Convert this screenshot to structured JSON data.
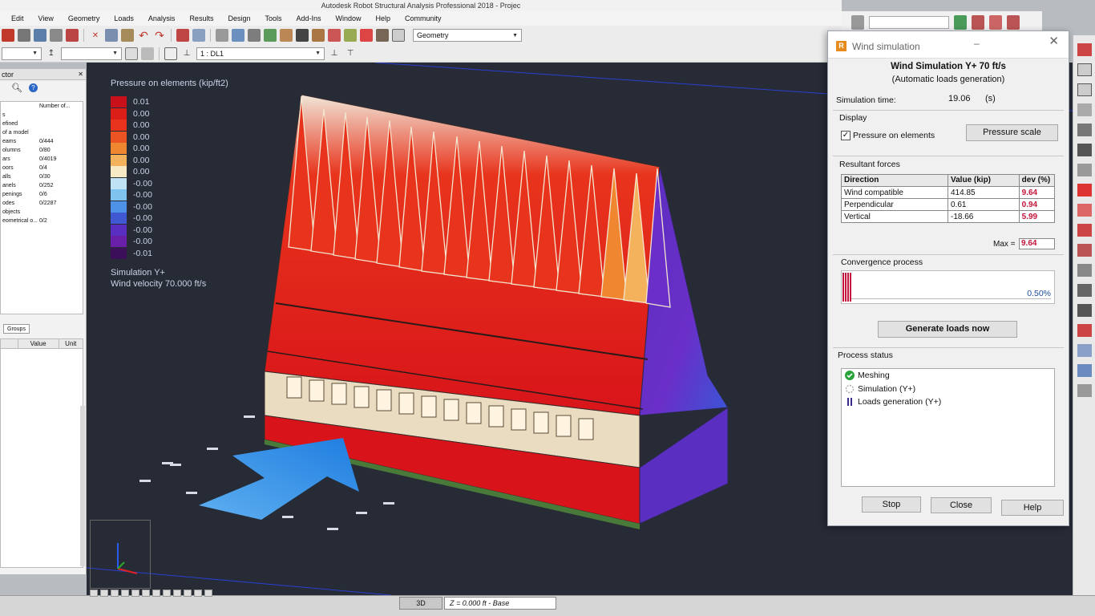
{
  "window": {
    "title": "Autodesk Robot Structural Analysis Professional 2018 - Projec"
  },
  "menu": [
    "Edit",
    "View",
    "Geometry",
    "Loads",
    "Analysis",
    "Results",
    "Design",
    "Tools",
    "Add-Ins",
    "Window",
    "Help",
    "Community"
  ],
  "toolbar": {
    "layout_select": "Geometry",
    "load_case_select": "1 : DL1"
  },
  "left_panel": {
    "header": "ctor",
    "col_header": "Number of...",
    "rows": [
      {
        "name": "",
        "value": ""
      },
      {
        "name": "s",
        "value": ""
      },
      {
        "name": "efined",
        "value": ""
      },
      {
        "name": "of a model",
        "value": ""
      },
      {
        "name": "eams",
        "value": "0/444"
      },
      {
        "name": "olumns",
        "value": "0/80"
      },
      {
        "name": "ars",
        "value": "0/4019"
      },
      {
        "name": "oors",
        "value": "0/4"
      },
      {
        "name": "alls",
        "value": "0/30"
      },
      {
        "name": "anels",
        "value": "0/252"
      },
      {
        "name": "penings",
        "value": "0/6"
      },
      {
        "name": "odes",
        "value": "0/2287"
      },
      {
        "name": "objects",
        "value": ""
      },
      {
        "name": "eometrical o...",
        "value": "0/2"
      }
    ],
    "tab_groups": "Groups",
    "prop_headers": [
      "Value",
      "Unit"
    ]
  },
  "legend": {
    "title": "Pressure on elements (kip/ft2)",
    "entries": [
      {
        "color": "#c8101b",
        "label": "0.01"
      },
      {
        "color": "#dc1e18",
        "label": "0.00"
      },
      {
        "color": "#e8341c",
        "label": "0.00"
      },
      {
        "color": "#ec5322",
        "label": "0.00"
      },
      {
        "color": "#f08630",
        "label": "0.00"
      },
      {
        "color": "#f4b25c",
        "label": "0.00"
      },
      {
        "color": "#f7e9c6",
        "label": "0.00"
      },
      {
        "color": "#bfe3f4",
        "label": "-0.00"
      },
      {
        "color": "#7ec4ef",
        "label": "-0.00"
      },
      {
        "color": "#4d92e6",
        "label": "-0.00"
      },
      {
        "color": "#4059d2",
        "label": "-0.00"
      },
      {
        "color": "#5a2ec0",
        "label": "-0.00"
      },
      {
        "color": "#6a1fa8",
        "label": "-0.00"
      },
      {
        "color": "#3c0f5a",
        "label": "-0.01"
      }
    ],
    "footer_line1": "Simulation Y+",
    "footer_line2": "Wind velocity 70.000 ft/s"
  },
  "statusbar": {
    "view_mode": "3D",
    "z_level": "Z = 0.000 ft - Base"
  },
  "dialog": {
    "title": "Wind simulation",
    "heading": "Wind Simulation Y+ 70 ft/s",
    "subheading": "(Automatic loads generation)",
    "sim_time_label": "Simulation time:",
    "sim_time_value": "19.06",
    "sim_time_unit": "(s)",
    "display_label": "Display",
    "pressure_checkbox": "Pressure on elements",
    "pressure_checked": true,
    "pressure_scale_btn": "Pressure scale",
    "resultant_label": "Resultant forces",
    "rf_headers": {
      "direction": "Direction",
      "value": "Value (kip)",
      "dev": "dev (%)"
    },
    "rf_rows": [
      {
        "direction": "Wind compatible",
        "value": "414.85",
        "dev": "9.64"
      },
      {
        "direction": "Perpendicular",
        "value": "0.61",
        "dev": "0.94"
      },
      {
        "direction": "Vertical",
        "value": "-18.66",
        "dev": "5.99"
      }
    ],
    "max_label": "Max =",
    "max_value": "9.64",
    "convergence_label": "Convergence process",
    "convergence_value": "0.50%",
    "generate_btn": "Generate loads now",
    "process_label": "Process status",
    "process_items": [
      {
        "label": "Meshing",
        "state": "done"
      },
      {
        "label": "Simulation (Y+)",
        "state": "running"
      },
      {
        "label": "Loads generation (Y+)",
        "state": "pending"
      }
    ],
    "stop_btn": "Stop",
    "close_btn": "Close",
    "help_btn": "Help"
  }
}
